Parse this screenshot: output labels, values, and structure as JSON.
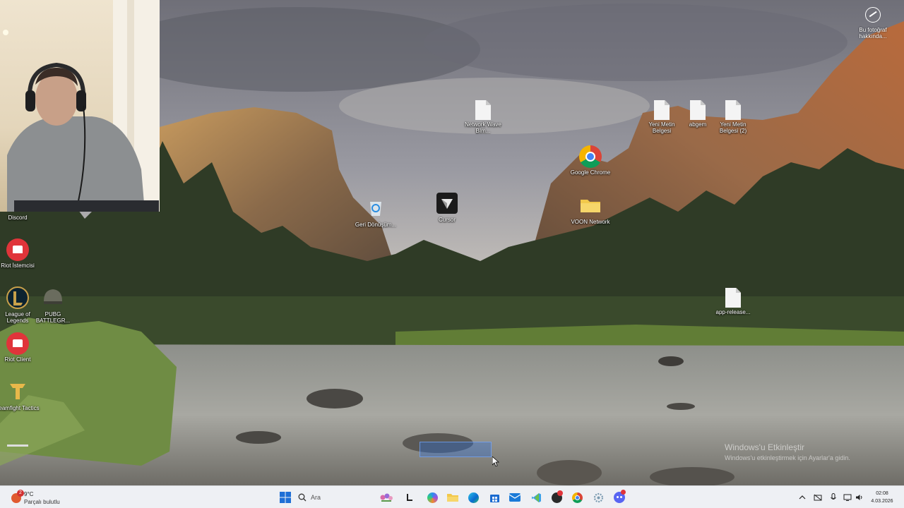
{
  "desktop": {
    "icons": [
      {
        "label": "Discord"
      },
      {
        "label": "Riot İstemcisi"
      },
      {
        "label": "League of Legends"
      },
      {
        "label": "PUBG BATTLEGR..."
      },
      {
        "label": "Riot Client"
      },
      {
        "label": "Teamfight Tactics"
      },
      {
        "label": "Geri Dönüşüm..."
      },
      {
        "label": "Cursor"
      },
      {
        "label": "Network Wave BIm..."
      },
      {
        "label": "Google Chrome"
      },
      {
        "label": "VOON Network"
      },
      {
        "label": "Yeni Metin Belgesi"
      },
      {
        "label": "abgem"
      },
      {
        "label": "Yeni Metin Belgesi (2)"
      },
      {
        "label": "app-release..."
      }
    ]
  },
  "photo_info": {
    "label": "Bu fotoğraf hakkında..."
  },
  "watermark": {
    "title": "Windows'u Etkinleştir",
    "subtitle": "Windows'u etkinleştirmek için Ayarlar'a gidin."
  },
  "taskbar": {
    "weather_badge": "2",
    "weather_temp": "9°C",
    "weather_desc": "Parçalı bulutlu",
    "search_placeholder": "Ara",
    "clock_time": "02:08",
    "clock_date": "4.03.2026"
  },
  "colors": {
    "taskbar_bg": "#eef0f4",
    "windows_blue": "#1f6fd6",
    "riot_red": "#e0343a",
    "discord_purple": "#5865f2"
  }
}
